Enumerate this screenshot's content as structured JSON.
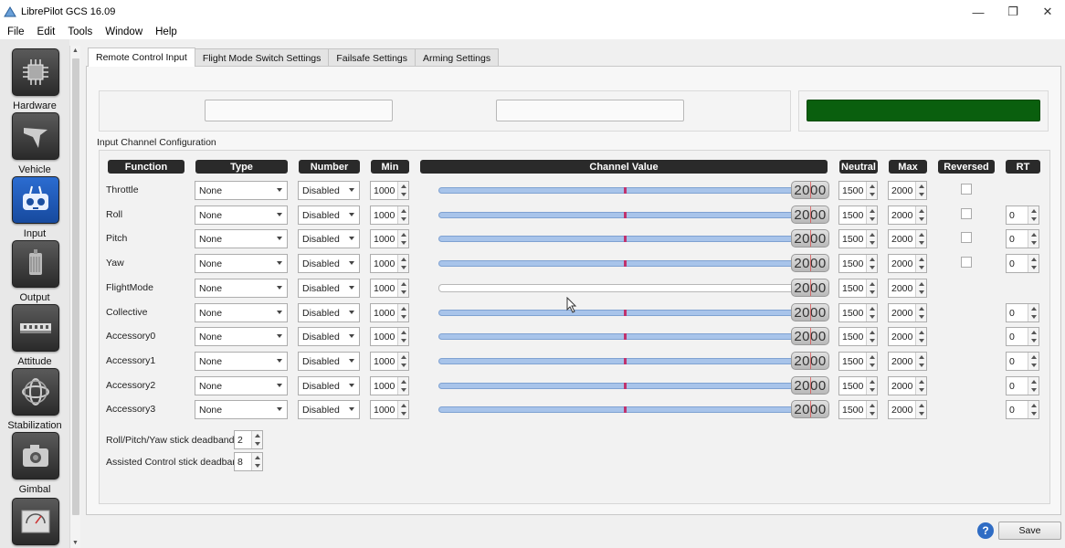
{
  "window": {
    "title": "LibrePilot GCS 16.09",
    "minimize": "—",
    "maximize": "❐",
    "close": "✕"
  },
  "menu": [
    "File",
    "Edit",
    "Tools",
    "Window",
    "Help"
  ],
  "sidebar": {
    "items": [
      {
        "label": "Hardware",
        "icon": "chip-icon"
      },
      {
        "label": "Vehicle",
        "icon": "aircraft-icon"
      },
      {
        "label": "Input",
        "icon": "remote-control-icon"
      },
      {
        "label": "Output",
        "icon": "motor-icon"
      },
      {
        "label": "Attitude",
        "icon": "attitude-board-icon"
      },
      {
        "label": "Stabilization",
        "icon": "gyro-icon"
      },
      {
        "label": "Gimbal",
        "icon": "camera-icon"
      },
      {
        "label": "",
        "icon": "meter-icon"
      }
    ],
    "active_index": 2
  },
  "tabs": [
    "Remote Control Input",
    "Flight Mode Switch Settings",
    "Failsafe Settings",
    "Arming Settings"
  ],
  "active_tab": 0,
  "group_title": "Input Channel Configuration",
  "headers": {
    "function": "Function",
    "type": "Type",
    "number": "Number",
    "min": "Min",
    "channel_value": "Channel Value",
    "neutral": "Neutral",
    "max": "Max",
    "reversed": "Reversed",
    "rt": "RT"
  },
  "rows": [
    {
      "function": "Throttle",
      "type": "None",
      "number": "Disabled",
      "min": "1000",
      "value": "2000",
      "neutral": "1500",
      "max": "2000",
      "reversed": false,
      "rt": ""
    },
    {
      "function": "Roll",
      "type": "None",
      "number": "Disabled",
      "min": "1000",
      "value": "2000",
      "neutral": "1500",
      "max": "2000",
      "reversed": false,
      "rt": "0"
    },
    {
      "function": "Pitch",
      "type": "None",
      "number": "Disabled",
      "min": "1000",
      "value": "2000",
      "neutral": "1500",
      "max": "2000",
      "reversed": false,
      "rt": "0"
    },
    {
      "function": "Yaw",
      "type": "None",
      "number": "Disabled",
      "min": "1000",
      "value": "2000",
      "neutral": "1500",
      "max": "2000",
      "reversed": false,
      "rt": "0"
    },
    {
      "function": "FlightMode",
      "type": "None",
      "number": "Disabled",
      "min": "1000",
      "value": "2000",
      "neutral": "1500",
      "max": "2000",
      "reversed": null,
      "rt": ""
    },
    {
      "function": "Collective",
      "type": "None",
      "number": "Disabled",
      "min": "1000",
      "value": "2000",
      "neutral": "1500",
      "max": "2000",
      "reversed": null,
      "rt": "0"
    },
    {
      "function": "Accessory0",
      "type": "None",
      "number": "Disabled",
      "min": "1000",
      "value": "2000",
      "neutral": "1500",
      "max": "2000",
      "reversed": null,
      "rt": "0"
    },
    {
      "function": "Accessory1",
      "type": "None",
      "number": "Disabled",
      "min": "1000",
      "value": "2000",
      "neutral": "1500",
      "max": "2000",
      "reversed": null,
      "rt": "0"
    },
    {
      "function": "Accessory2",
      "type": "None",
      "number": "Disabled",
      "min": "1000",
      "value": "2000",
      "neutral": "1500",
      "max": "2000",
      "reversed": null,
      "rt": "0"
    },
    {
      "function": "Accessory3",
      "type": "None",
      "number": "Disabled",
      "min": "1000",
      "value": "2000",
      "neutral": "1500",
      "max": "2000",
      "reversed": null,
      "rt": "0"
    }
  ],
  "deadbands": {
    "rpy_label": "Roll/Pitch/Yaw stick deadband",
    "rpy_value": "2",
    "assisted_label": "Assisted Control stick deadband",
    "assisted_value": "8"
  },
  "footer": {
    "help": "?",
    "save": "Save"
  },
  "colors": {
    "accent_green": "#0a5f0e",
    "slider_fill": "#a8c4ea",
    "header_bg": "#2a2a2a"
  }
}
